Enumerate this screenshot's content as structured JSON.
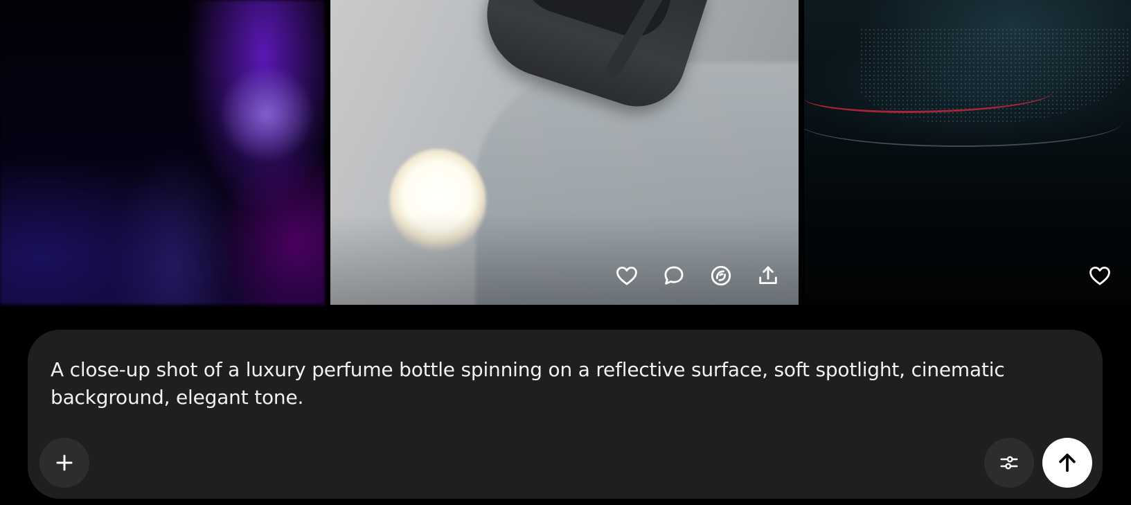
{
  "gallery": {
    "tiles": [
      {
        "name": "purple-blur-tile"
      },
      {
        "name": "watch-sun-tile"
      },
      {
        "name": "car-detail-tile"
      }
    ],
    "actions": [
      {
        "icon": "heart-icon"
      },
      {
        "icon": "comment-icon"
      },
      {
        "icon": "remix-icon"
      },
      {
        "icon": "share-icon"
      }
    ],
    "right_action": {
      "icon": "heart-icon"
    }
  },
  "composer": {
    "prompt": "A close-up shot of a luxury perfume bottle spinning on a reflective surface, soft spotlight, cinematic background, elegant tone.",
    "add_icon": "plus-icon",
    "settings_icon": "sliders-icon",
    "send_icon": "arrow-up-icon"
  }
}
